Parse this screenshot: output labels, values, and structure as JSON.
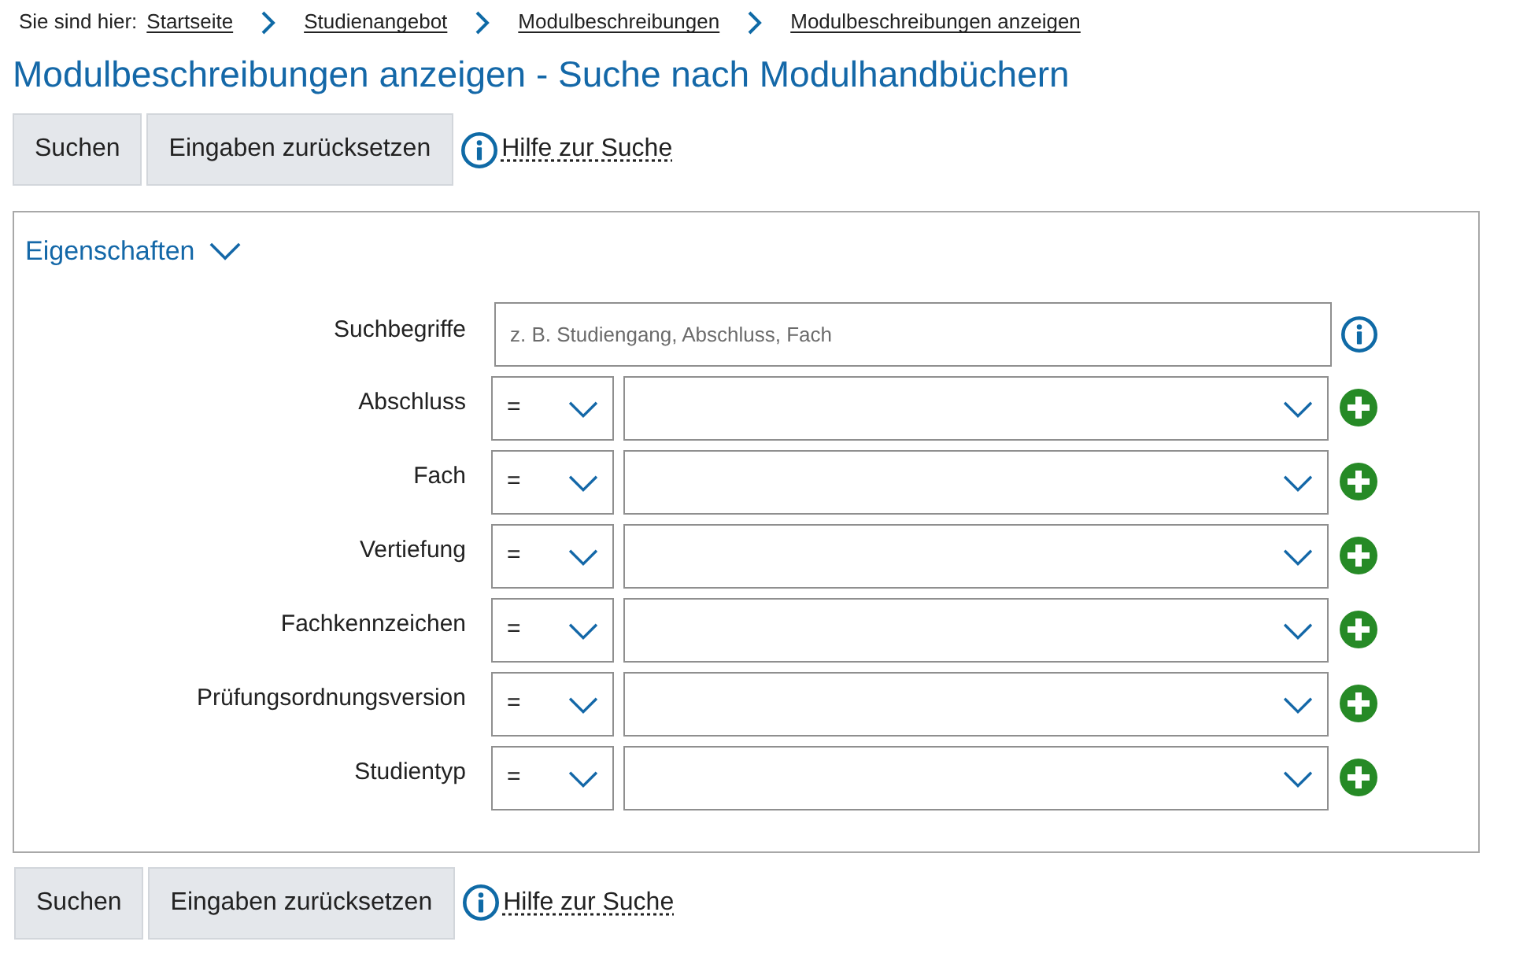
{
  "breadcrumb": {
    "label": "Sie sind hier:",
    "items": [
      {
        "label": "Startseite"
      },
      {
        "label": "Studienangebot"
      },
      {
        "label": "Modulbeschreibungen"
      },
      {
        "label": "Modulbeschreibungen anzeigen"
      }
    ]
  },
  "title": "Modulbeschreibungen anzeigen - Suche nach Modulhandbüchern",
  "toolbar_top": {
    "buttons": [
      "Suchen",
      "Eingaben zurücksetzen"
    ],
    "help_link": "Hilfe zur Suche"
  },
  "panel": {
    "heading": "Eigenschaften",
    "expanded": true,
    "search_field": {
      "label": "Suchbegriffe",
      "placeholder": "z. B. Studiengang, Abschluss, Fach"
    },
    "filters": [
      {
        "label": "Abschluss",
        "operator": "="
      },
      {
        "label": "Fach",
        "operator": "="
      },
      {
        "label": "Vertiefung",
        "operator": "="
      },
      {
        "label": "Fachkennzeichen",
        "operator": "="
      },
      {
        "label": "Prüfungsordnungsversion",
        "operator": "="
      },
      {
        "label": "Studientyp",
        "operator": "="
      }
    ]
  },
  "toolbar_bottom": {
    "buttons": [
      "Suchen",
      "Eingaben zurücksetzen"
    ],
    "help_link": "Hilfe zur Suche"
  }
}
